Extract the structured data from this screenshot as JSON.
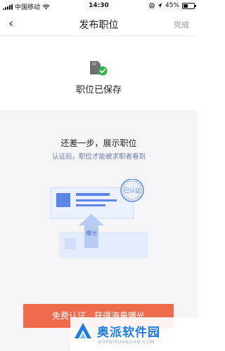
{
  "statusbar": {
    "carrier": "中国移动",
    "time": "14:30",
    "battery_percent": "45%",
    "battery_level": 0.45
  },
  "navbar": {
    "back_label": "‹",
    "title": "发布职位",
    "done_label": "完成"
  },
  "saved": {
    "text": "职位已保存"
  },
  "promo": {
    "headline": "还差一步，展示职位",
    "subline": "认证后，职位才能被求职者看到",
    "stamp_label": "已认证",
    "arrow_label": "曝光"
  },
  "cta": {
    "label": "免费认证，获得海量曝光"
  },
  "watermark": {
    "brand": "奥派软件园",
    "sub": "AOPAIRUANJIAN.COM"
  },
  "colors": {
    "accent": "#ee6b4d",
    "link": "#6b78a8",
    "success": "#2eb34a",
    "illustration": "#5b86e5"
  }
}
